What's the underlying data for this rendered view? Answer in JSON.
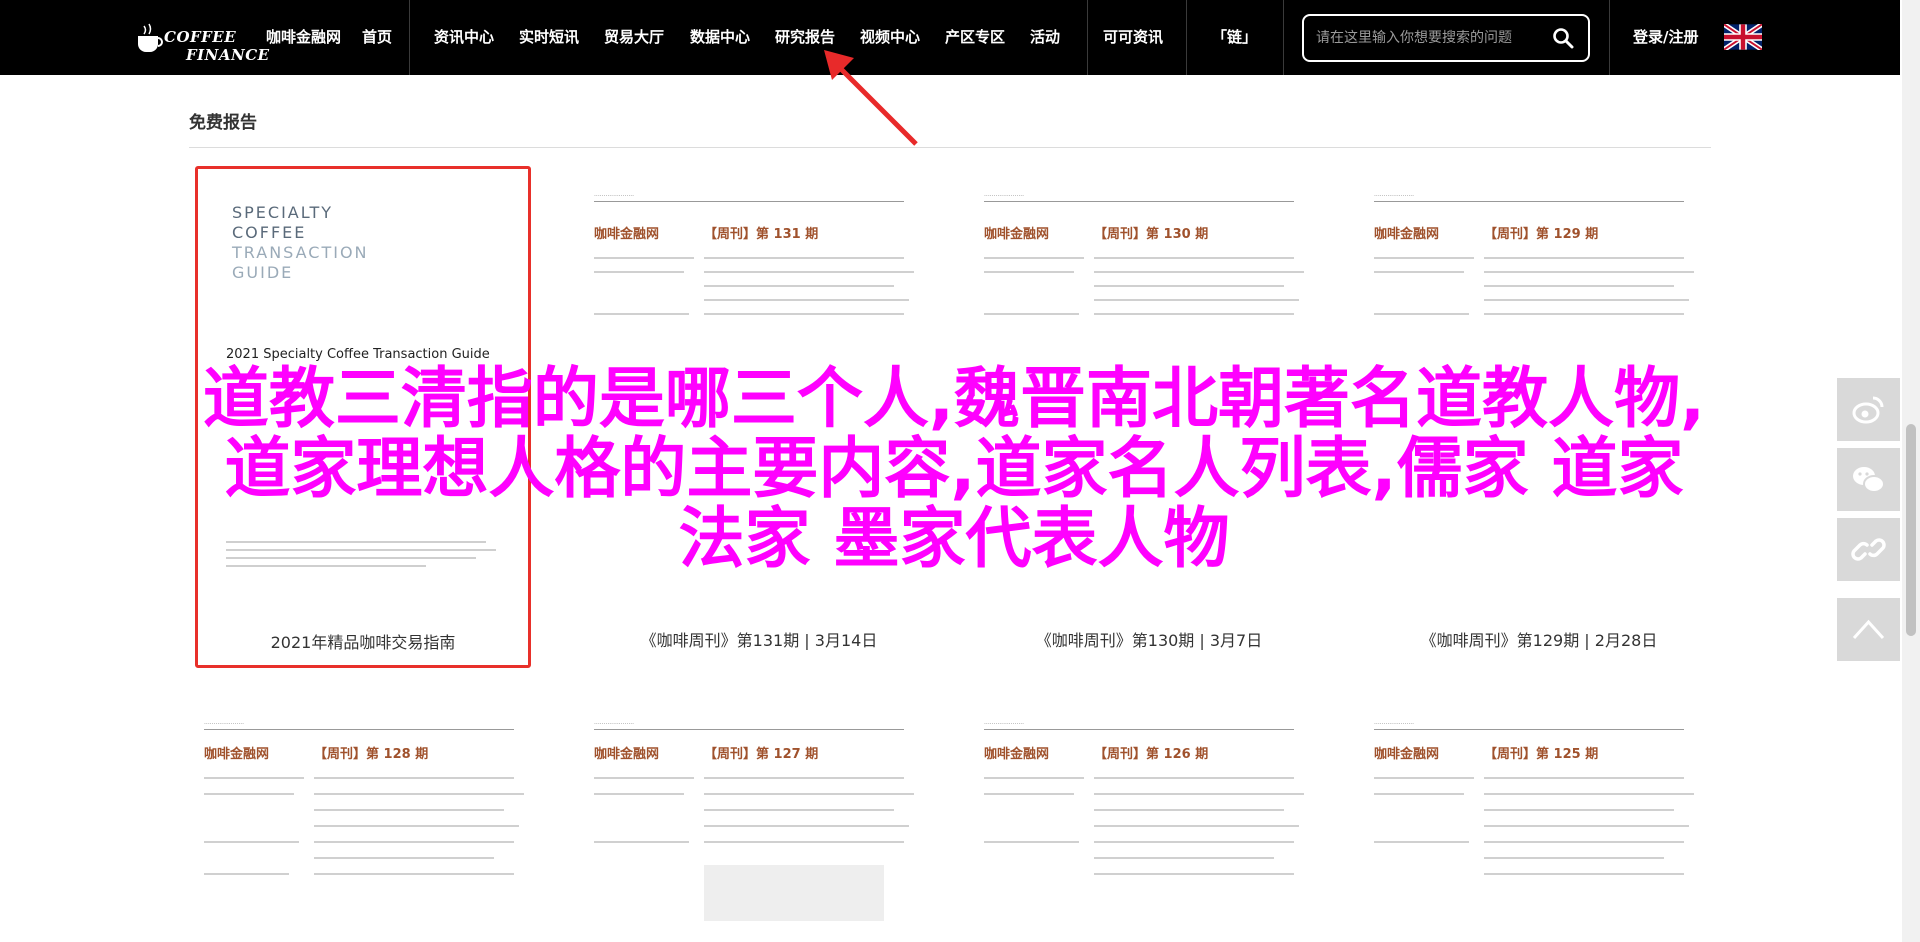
{
  "header": {
    "logo_line1": "COFFEE",
    "logo_line2": "FINANCE",
    "nav": [
      {
        "label": "咖啡金融网"
      },
      {
        "label": "首页"
      },
      {
        "label": "资讯中心"
      },
      {
        "label": "实时短讯"
      },
      {
        "label": "贸易大厅"
      },
      {
        "label": "数据中心"
      },
      {
        "label": "研究报告"
      },
      {
        "label": "视频中心"
      },
      {
        "label": "产区专区"
      },
      {
        "label": "活动"
      },
      {
        "label": "可可资讯"
      },
      {
        "label": "「链」"
      }
    ],
    "search_placeholder": "请在这里输入你想要搜索的问题",
    "login": "登录/注册",
    "flag_icon": "uk-flag-icon"
  },
  "section": {
    "title": "免费报告"
  },
  "reports_row1": [
    {
      "caption": "2021年精品咖啡交易指南",
      "cover_title": [
        "SPECIALTY",
        "COFFEE",
        "TRANSACTION",
        "GUIDE"
      ],
      "cover_subtitle": "2021 Specialty Coffee Transaction Guide"
    },
    {
      "caption": "《咖啡周刊》第131期 | 3月14日",
      "brand": "咖啡金融网",
      "issue": "【周刊】第 131 期"
    },
    {
      "caption": "《咖啡周刊》第130期 | 3月7日",
      "brand": "咖啡金融网",
      "issue": "【周刊】第 130 期"
    },
    {
      "caption": "《咖啡周刊》第129期 | 2月28日",
      "brand": "咖啡金融网",
      "issue": "【周刊】第 129 期"
    }
  ],
  "reports_row2": [
    {
      "brand": "咖啡金融网",
      "issue": "【周刊】第 128 期"
    },
    {
      "brand": "咖啡金融网",
      "issue": "【周刊】第 127 期"
    },
    {
      "brand": "咖啡金融网",
      "issue": "【周刊】第 126 期"
    },
    {
      "brand": "咖啡金融网",
      "issue": "【周刊】第 125 期"
    }
  ],
  "overlay": {
    "line1": "道教三清指的是哪三个人,魏晋南北朝著名道教人物,",
    "line2": "道家理想人格的主要内容,道家名人列表,儒家 道家",
    "line3": "法家 墨家代表人物"
  },
  "share": [
    "weibo-icon",
    "wechat-icon",
    "link-icon",
    "back-to-top-icon"
  ],
  "colors": {
    "nav_bg": "#000000",
    "overlay_text": "#ff00ff",
    "highlight_border": "#e8302a",
    "brand_text": "#a0522d"
  }
}
